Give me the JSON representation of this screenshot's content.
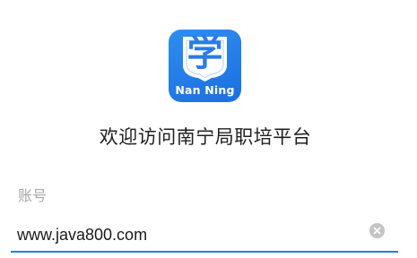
{
  "logo": {
    "glyph": "学",
    "caption": "Nan Ning",
    "icon": "school-shield-icon",
    "color_top": "#2f8df0",
    "color_bottom": "#1b6fe0"
  },
  "welcome": {
    "title": "欢迎访问南宁局职培平台"
  },
  "account_field": {
    "label": "账号",
    "value": "www.java800.com",
    "clear_icon": "clear-circle-icon",
    "accent_color": "#1d7fe6"
  }
}
